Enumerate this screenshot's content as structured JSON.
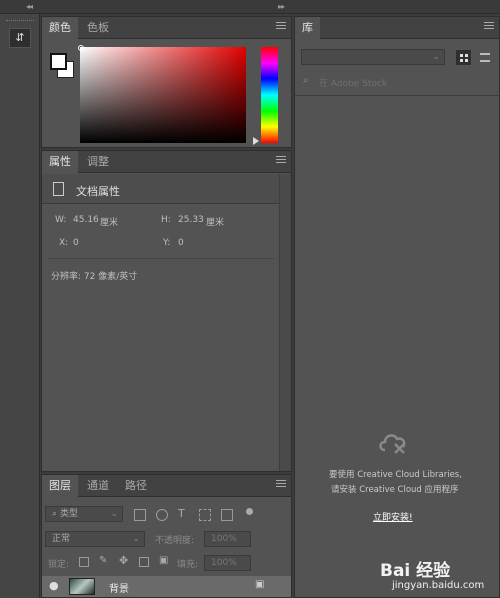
{
  "color_panel": {
    "tabs": [
      "颜色",
      "色板"
    ]
  },
  "properties_panel": {
    "tabs": [
      "属性",
      "调整"
    ],
    "doc_title": "文档属性",
    "w_label": "W:",
    "w_value": "45.16",
    "w_unit": "厘米",
    "h_label": "H:",
    "h_value": "25.33",
    "h_unit": "厘米",
    "x_label": "X:",
    "x_value": "0",
    "y_label": "Y:",
    "y_value": "0",
    "resolution": "分辨率: 72 像素/英寸"
  },
  "layers_panel": {
    "tabs": [
      "图层",
      "通道",
      "路径"
    ],
    "filter_kind": "类型",
    "blend_mode": "正常",
    "opacity_label": "不透明度:",
    "opacity_value": "100%",
    "lock_label": "锁定:",
    "fill_label": "填充:",
    "fill_value": "100%",
    "layer_name": "背景"
  },
  "library_panel": {
    "tab": "库",
    "search_placeholder": "在 Adobe Stock",
    "message_line1": "要使用 Creative Cloud Libraries,",
    "message_line2": "请安装 Creative Cloud 应用程序",
    "install_link": "立即安装!"
  },
  "watermark": {
    "brand": "Bai 经验",
    "url": "jingyan.baidu.com"
  }
}
